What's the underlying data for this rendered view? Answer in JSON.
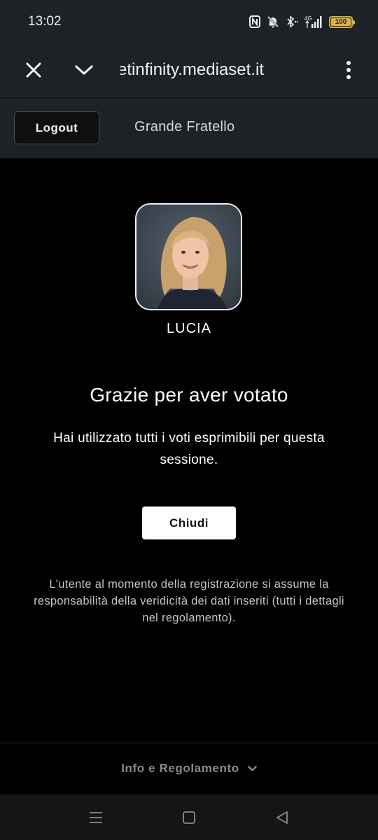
{
  "status_bar": {
    "time": "13:02",
    "network": "4G",
    "battery_level": "100",
    "battery_fraction": 1.0,
    "icons": [
      "nfc-icon",
      "mute-icon",
      "bluetooth-icon",
      "signal-icon",
      "battery-icon"
    ]
  },
  "browser": {
    "url": "etinfinity.mediaset.it",
    "icons": [
      "close-icon",
      "chevron-down-icon",
      "more-vert-icon"
    ]
  },
  "header": {
    "logout_label": "Logout",
    "title": "Grande Fratello"
  },
  "vote": {
    "contestant_name": "LUCIA",
    "title": "Grazie per aver votato",
    "message": "Hai utilizzato tutti i voti esprimibili per questa sessione.",
    "close_label": "Chiudi",
    "disclaimer": "L'utente al momento della registrazione si assume la responsabilità della veridicità dei dati inseriti (tutti i dettagli nel regolamento)."
  },
  "footer": {
    "link_label": "Info e Regolamento"
  },
  "colors": {
    "bar_bg": "#1e2126",
    "page_bg": "#000000",
    "battery": "#d9b24a",
    "button_bg": "#ffffff"
  }
}
